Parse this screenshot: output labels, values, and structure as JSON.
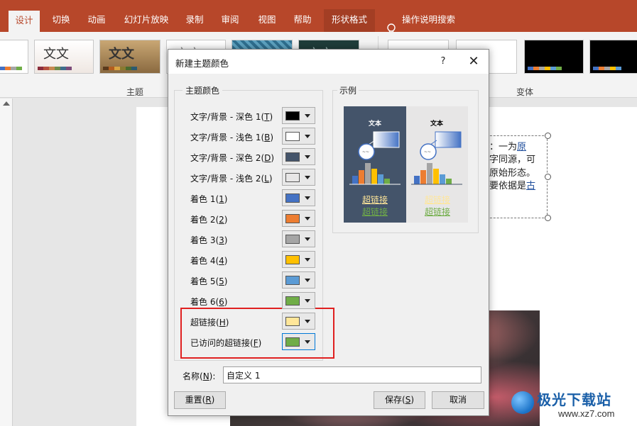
{
  "ribbon": {
    "tabs": [
      {
        "label": "设计",
        "active": true
      },
      {
        "label": "切换"
      },
      {
        "label": "动画"
      },
      {
        "label": "幻灯片放映"
      },
      {
        "label": "录制"
      },
      {
        "label": "审阅"
      },
      {
        "label": "视图"
      },
      {
        "label": "帮助"
      },
      {
        "label": "形状格式"
      }
    ],
    "search_label": "操作说明搜索",
    "group_themes": "主题",
    "group_variants": "变体",
    "theme_thumb_text": [
      "文文",
      "文文",
      "文文",
      "文文"
    ]
  },
  "dialog": {
    "title": "新建主题颜色",
    "help_glyph": "?",
    "close_glyph": "✕",
    "theme_colors_label": "主题颜色",
    "sample_label": "示例",
    "rows": [
      {
        "pre": "文字/背景 - 深色 1(",
        "key": "T",
        "post": ")",
        "color": "#000000"
      },
      {
        "pre": "文字/背景 - 浅色 1(",
        "key": "B",
        "post": ")",
        "color": "#ffffff"
      },
      {
        "pre": "文字/背景 - 深色 2(",
        "key": "D",
        "post": ")",
        "color": "#44546a"
      },
      {
        "pre": "文字/背景 - 浅色 2(",
        "key": "L",
        "post": ")",
        "color": "#e7e6e6"
      },
      {
        "pre": "着色 1(",
        "key": "1",
        "post": ")",
        "color": "#4472c4"
      },
      {
        "pre": "着色 2(",
        "key": "2",
        "post": ")",
        "color": "#ed7d31"
      },
      {
        "pre": "着色 3(",
        "key": "3",
        "post": ")",
        "color": "#a5a5a5"
      },
      {
        "pre": "着色 4(",
        "key": "4",
        "post": ")",
        "color": "#ffc000"
      },
      {
        "pre": "着色 5(",
        "key": "5",
        "post": ")",
        "color": "#5b9bd5"
      },
      {
        "pre": "着色 6(",
        "key": "6",
        "post": ")",
        "color": "#70ad47"
      },
      {
        "pre": "超链接(",
        "key": "H",
        "post": ")",
        "color": "#ffe699"
      },
      {
        "pre": "已访问的超链接(",
        "key": "F",
        "post": ")",
        "color": "#70ad47"
      }
    ],
    "sample": {
      "text": "文本",
      "hyperlink": "超链接",
      "visited": "超链接",
      "dark_text_color": "#ffffff",
      "light_text_color": "#000000",
      "hyperlink_color": "#ffe699",
      "visited_color": "#70ad47"
    },
    "name_label_pre": "名称(",
    "name_label_key": "N",
    "name_label_post": "):",
    "name_value": "自定义 1",
    "reset": {
      "pre": "重置(",
      "key": "R",
      "post": ")"
    },
    "save": {
      "pre": "保存(",
      "key": "S",
      "post": ")"
    },
    "cancel": "取消"
  },
  "slide": {
    "lines": [
      {
        "text": "：一为",
        "link": "原"
      },
      {
        "text": "字同源，可",
        "link": ""
      },
      {
        "text": "原始形态。",
        "link": ""
      },
      {
        "text": "要依据是",
        "link": "古"
      }
    ]
  },
  "watermark": {
    "title": "极光下载站",
    "url": "www.xz7.com"
  }
}
